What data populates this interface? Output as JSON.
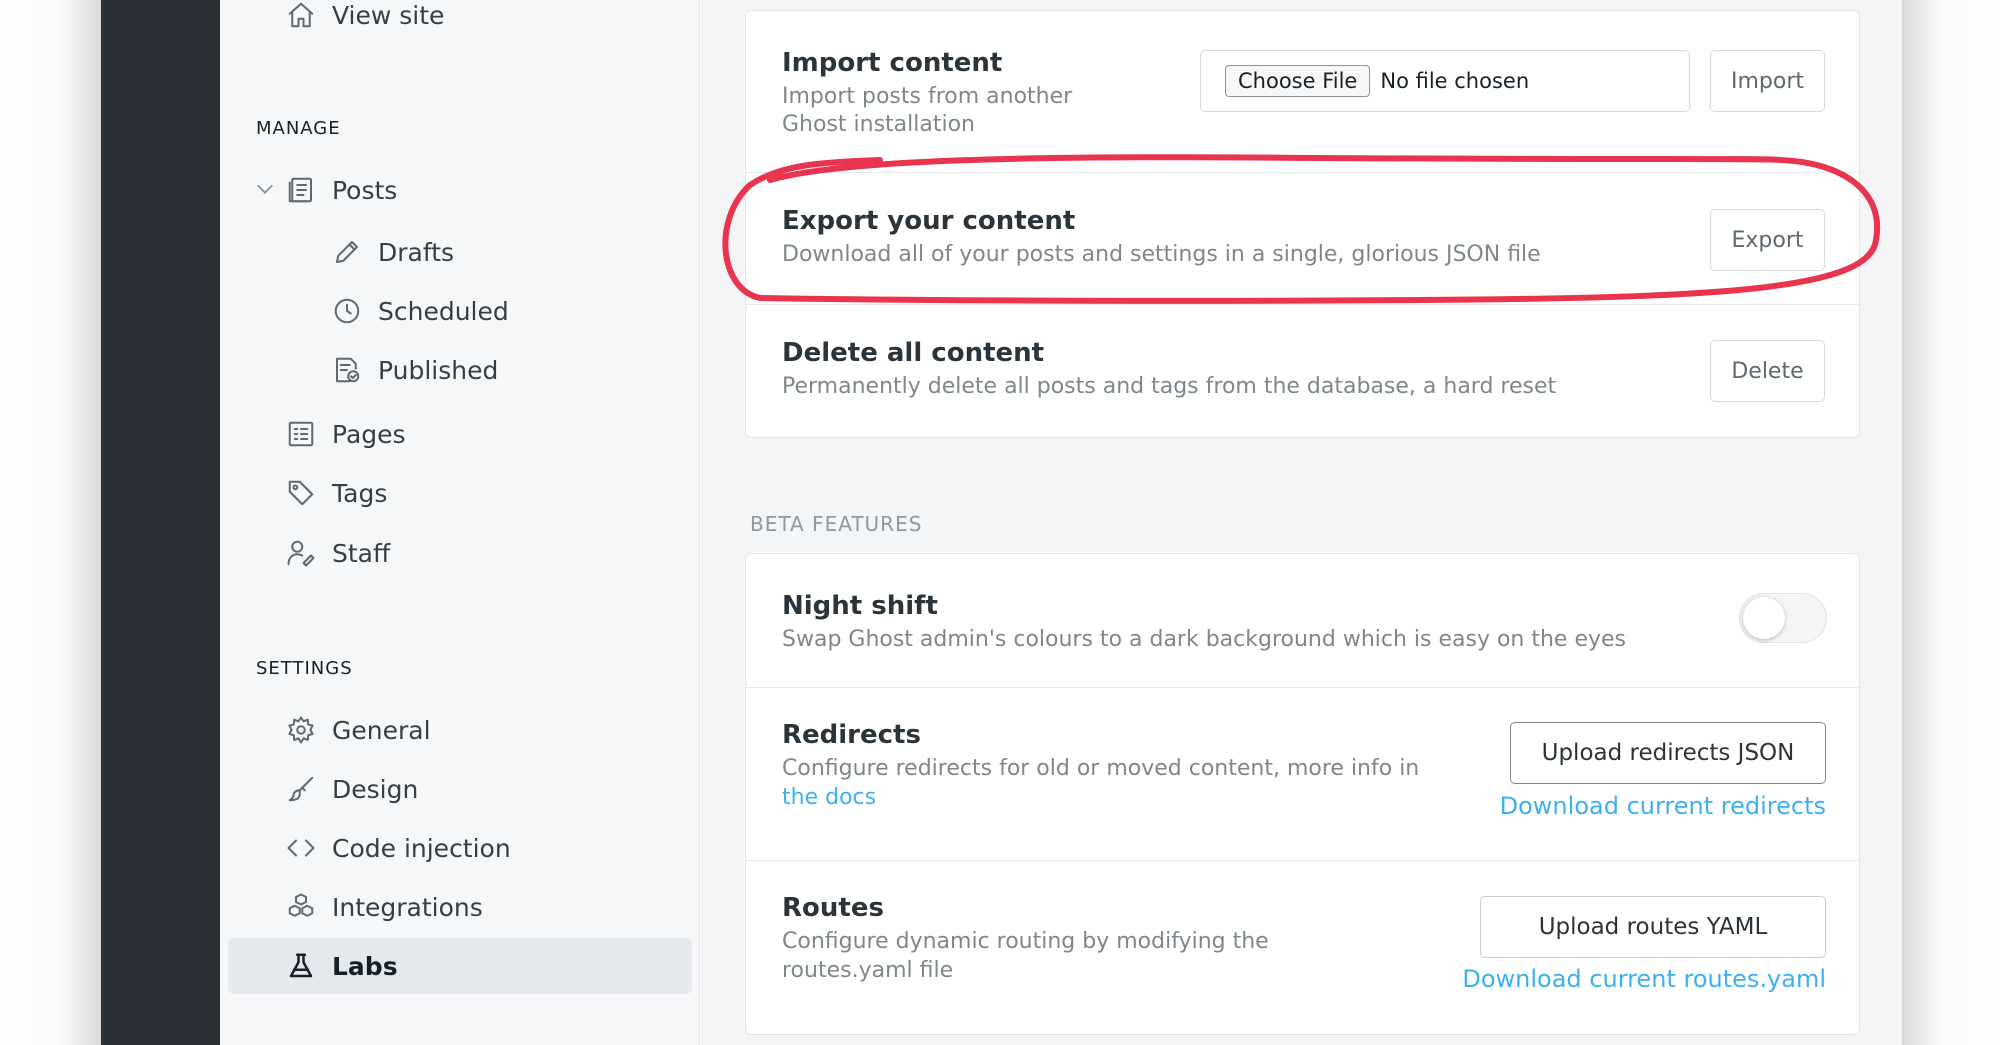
{
  "sidebar": {
    "view_site": "View site",
    "manage_heading": "MANAGE",
    "posts": "Posts",
    "drafts": "Drafts",
    "scheduled": "Scheduled",
    "published": "Published",
    "pages": "Pages",
    "tags": "Tags",
    "staff": "Staff",
    "settings_heading": "SETTINGS",
    "general": "General",
    "design": "Design",
    "code_injection": "Code injection",
    "integrations": "Integrations",
    "labs": "Labs"
  },
  "import": {
    "title": "Import content",
    "desc_line1": "Import posts from another",
    "desc_line2": "Ghost installation",
    "choose_file": "Choose File",
    "no_file": "No file chosen",
    "button": "Import"
  },
  "export": {
    "title": "Export your content",
    "desc": "Download all of your posts and settings in a single, glorious JSON file",
    "button": "Export"
  },
  "delete": {
    "title": "Delete all content",
    "desc": "Permanently delete all posts and tags from the database, a hard reset",
    "button": "Delete"
  },
  "beta": {
    "heading": "BETA FEATURES",
    "night_shift": {
      "title": "Night shift",
      "desc": "Swap Ghost admin's colours to a dark background which is easy on the eyes",
      "enabled": false
    },
    "redirects": {
      "title": "Redirects",
      "desc": "Configure redirects for old or moved content, more info in",
      "docs_link": "the docs",
      "upload_button": "Upload redirects JSON",
      "download_link": "Download current redirects"
    },
    "routes": {
      "title": "Routes",
      "desc_line1": "Configure dynamic routing by modifying the",
      "desc_line2": "routes.yaml file",
      "upload_button": "Upload routes YAML",
      "download_link": "Download current routes.yaml"
    }
  },
  "colors": {
    "accent_link": "#3eb0ef",
    "annotation": "#e8344e",
    "rail": "#2b2f36"
  }
}
